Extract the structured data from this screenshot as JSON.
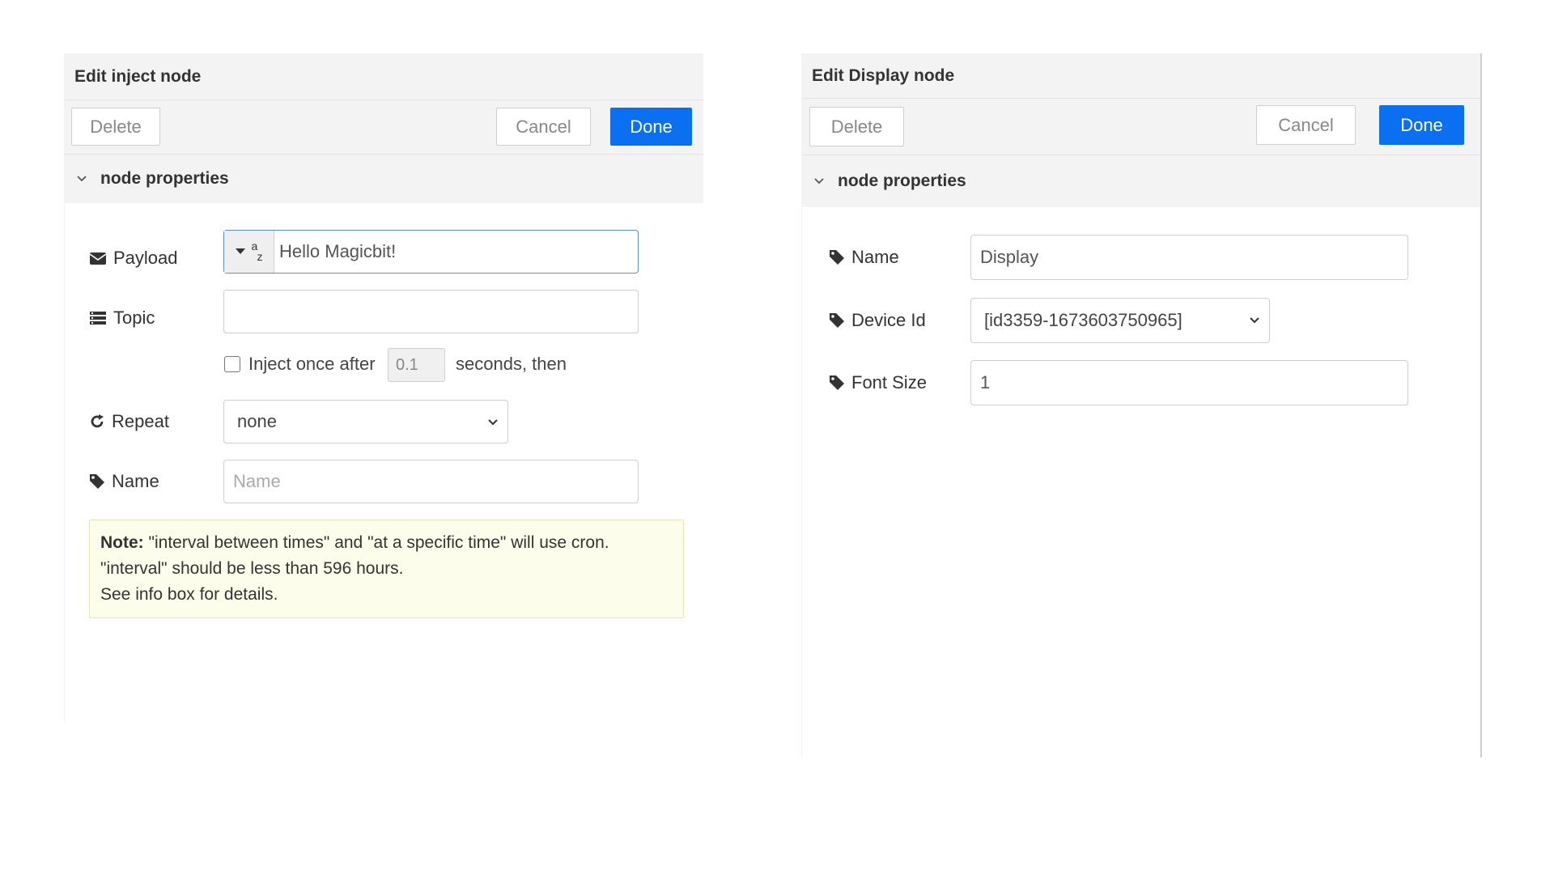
{
  "inject_dialog": {
    "title": "Edit inject node",
    "delete_label": "Delete",
    "cancel_label": "Cancel",
    "done_label": "Done",
    "section_label": "node properties",
    "fields": {
      "payload_label": "Payload",
      "payload_type_glyph_top": "a",
      "payload_type_glyph_bottom": "z",
      "payload_value": "Hello Magicbit!",
      "topic_label": "Topic",
      "topic_value": "",
      "inject_once_label": "Inject once after",
      "inject_once_value": "0.1",
      "seconds_then_label": "seconds, then",
      "repeat_label": "Repeat",
      "repeat_value": "none",
      "name_label": "Name",
      "name_placeholder": "Name"
    },
    "note": {
      "bold": "Note:",
      "line1": "\"interval between times\" and \"at a specific time\" will use cron.",
      "line2": "\"interval\" should be less than 596 hours.",
      "line3": "See info box for details."
    }
  },
  "display_dialog": {
    "title": "Edit Display node",
    "delete_label": "Delete",
    "cancel_label": "Cancel",
    "done_label": "Done",
    "section_label": "node properties",
    "fields": {
      "name_label": "Name",
      "name_value": "Display",
      "device_label": "Device Id",
      "device_value": "[id3359-1673603750965]",
      "font_size_label": "Font Size",
      "font_size_value": "1"
    }
  },
  "colors": {
    "primary_button": "#0a6ff0",
    "header_bg": "#f3f3f3",
    "note_bg": "#fdfdec"
  },
  "icons": [
    "envelope-icon",
    "list-icon",
    "refresh-icon",
    "tag-icon",
    "chevron-down-icon",
    "caret-down-icon"
  ]
}
